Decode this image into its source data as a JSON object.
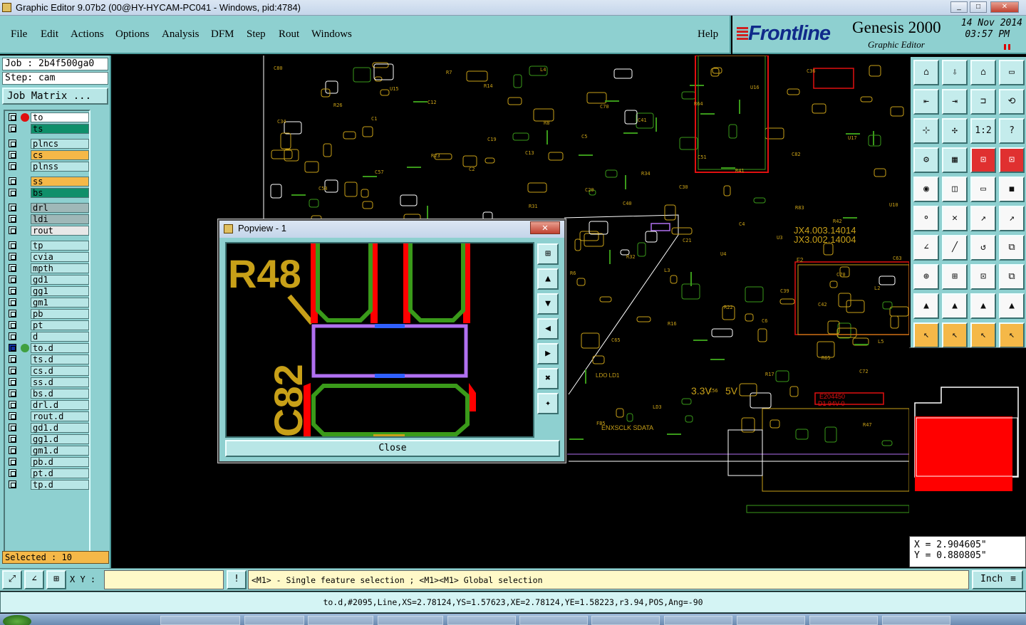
{
  "window": {
    "title": "Graphic Editor 9.07b2 (00@HY-HYCAM-PC041 - Windows, pid:4784)",
    "min": "_",
    "max": "□",
    "close": "✕"
  },
  "menu": {
    "items": [
      "File",
      "Edit",
      "Actions",
      "Options",
      "Analysis",
      "DFM",
      "Step",
      "Rout",
      "Windows"
    ],
    "help": "Help"
  },
  "brand": {
    "logo": "Frontline",
    "product": "Genesis 2000",
    "subtitle": "Graphic Editor",
    "date": "14 Nov 2014",
    "time": "03:57 PM"
  },
  "job": {
    "job_label": "Job : 2b4f500ga0",
    "step_label": "Step: cam",
    "matrix_button": "Job Matrix ..."
  },
  "layers": [
    {
      "name": "to",
      "bg": "#ffffff",
      "marker": "red-dot"
    },
    {
      "name": "ts",
      "bg": "#0f8f6a"
    },
    {
      "name": "plncs",
      "bg": "#b8e6e6"
    },
    {
      "name": "cs",
      "bg": "#f5b848"
    },
    {
      "name": "plnss",
      "bg": "#b8e6e6"
    },
    {
      "name": "ss",
      "bg": "#f5b848"
    },
    {
      "name": "bs",
      "bg": "#0f8f6a"
    },
    {
      "name": "drl",
      "bg": "#9fb8b8"
    },
    {
      "name": "ldi",
      "bg": "#9fb8b8"
    },
    {
      "name": "rout",
      "bg": "#e8e8e8"
    },
    {
      "name": "tp",
      "bg": "#b8e6e6"
    },
    {
      "name": "cvia",
      "bg": "#b8e6e6"
    },
    {
      "name": "mpth",
      "bg": "#b8e6e6"
    },
    {
      "name": "gd1",
      "bg": "#b8e6e6"
    },
    {
      "name": "gg1",
      "bg": "#b8e6e6"
    },
    {
      "name": "gm1",
      "bg": "#b8e6e6"
    },
    {
      "name": "pb",
      "bg": "#b8e6e6"
    },
    {
      "name": "pt",
      "bg": "#b8e6e6"
    },
    {
      "name": "d",
      "bg": "#b8e6e6"
    },
    {
      "name": "to.d",
      "bg": "#b8e6e6",
      "marker": "work-icon"
    },
    {
      "name": "ts.d",
      "bg": "#b8e6e6"
    },
    {
      "name": "cs.d",
      "bg": "#b8e6e6"
    },
    {
      "name": "ss.d",
      "bg": "#b8e6e6"
    },
    {
      "name": "bs.d",
      "bg": "#b8e6e6"
    },
    {
      "name": "drl.d",
      "bg": "#b8e6e6"
    },
    {
      "name": "rout.d",
      "bg": "#b8e6e6"
    },
    {
      "name": "gd1.d",
      "bg": "#b8e6e6"
    },
    {
      "name": "gg1.d",
      "bg": "#b8e6e6"
    },
    {
      "name": "gm1.d",
      "bg": "#b8e6e6"
    },
    {
      "name": "pb.d",
      "bg": "#b8e6e6"
    },
    {
      "name": "pt.d",
      "bg": "#b8e6e6"
    },
    {
      "name": "tp.d",
      "bg": "#b8e6e6"
    }
  ],
  "selected": "Selected : 10",
  "popview": {
    "title": "Popview - 1",
    "close_x": "✕",
    "close_button": "Close",
    "labels": {
      "r48": "R48",
      "c82": "C82"
    }
  },
  "board_labels": [
    "C80",
    "C1",
    "C2",
    "U2",
    "L3",
    "C6",
    "C72",
    "C73",
    "C12",
    "C13",
    "C40",
    "U4",
    "C42",
    "C43",
    "R15",
    "R14",
    "C5",
    "C30",
    "U3",
    "L2",
    "R10",
    "C48",
    "L4",
    "C41",
    "R41",
    "R42",
    "U5",
    "C74",
    "R53",
    "FB5",
    "R64",
    "C82",
    "U10",
    "R50",
    "C15",
    "C16",
    "LD3",
    "U16",
    "U17",
    "C58",
    "R51",
    "R74",
    "C65",
    "C56",
    "C36",
    "C34",
    "C57",
    "C94",
    "R6",
    "R16",
    "R17",
    "R47",
    "R26",
    "R23",
    "R31",
    "R32",
    "R22",
    "R65",
    "R62",
    "U15",
    "C19",
    "C20",
    "C21",
    "C39",
    "L5",
    "C3",
    "R7",
    "R8",
    "R34",
    "C4",
    "C70",
    "C61",
    "R11",
    "D1",
    "C70",
    "C51",
    "R83",
    "C63",
    "C27"
  ],
  "board_text": {
    "jx1": "JX4.003.14014",
    "jx2": "JX3.002.14004",
    "v1": "3.3V",
    "v2": "5V",
    "mark": "E204450",
    "mark2": "D1 94V-0",
    "enx": "ENXSCLK SDATA",
    "f2": "F2",
    "u10b": "LDO LD1"
  },
  "coords": {
    "x": "X = 2.904605\"",
    "y": "Y = 0.880805\""
  },
  "cmd": {
    "xy_label": "X Y :",
    "xy_value": "",
    "message": "<M1> - Single feature selection ; <M1><M1> Global selection",
    "unit": "Inch"
  },
  "status": "to.d,#2095,Line,XS=2.78124,YS=1.57623,XE=2.78124,YE=1.58223,r3.94,POS,Ang=-90",
  "tools": [
    "home-icon",
    "zoom-in-icon",
    "house-icon",
    "window-icon",
    "pan-left-icon",
    "pan-right-icon",
    "fit-icon",
    "swap-icon",
    "zoom-fit-icon",
    "zoom-box-icon",
    "one-to-one-icon",
    "help-icon",
    "measure-icon",
    "grid-icon",
    "snap-icon",
    "snap-red-icon",
    "add-pad-icon",
    "draw-line-icon",
    "ruler-icon",
    "circle-pad-icon",
    "connect-icon",
    "cross-icon",
    "line-node-icon",
    "line-node-red-icon",
    "angle-icon",
    "slash-icon",
    "rotate-icon",
    "mirror-icon",
    "node-move-icon",
    "flip-icon",
    "box-select-icon",
    "overlay-icon",
    "triangle-icon",
    "triangle-up-icon",
    "triangle-a-icon",
    "triangle-b-icon",
    "pointer-icon",
    "pointer2-icon",
    "pointer3-icon",
    "pointer4-icon"
  ],
  "tool_labels": {
    "one_to_one": "1:2",
    "help": "?"
  }
}
